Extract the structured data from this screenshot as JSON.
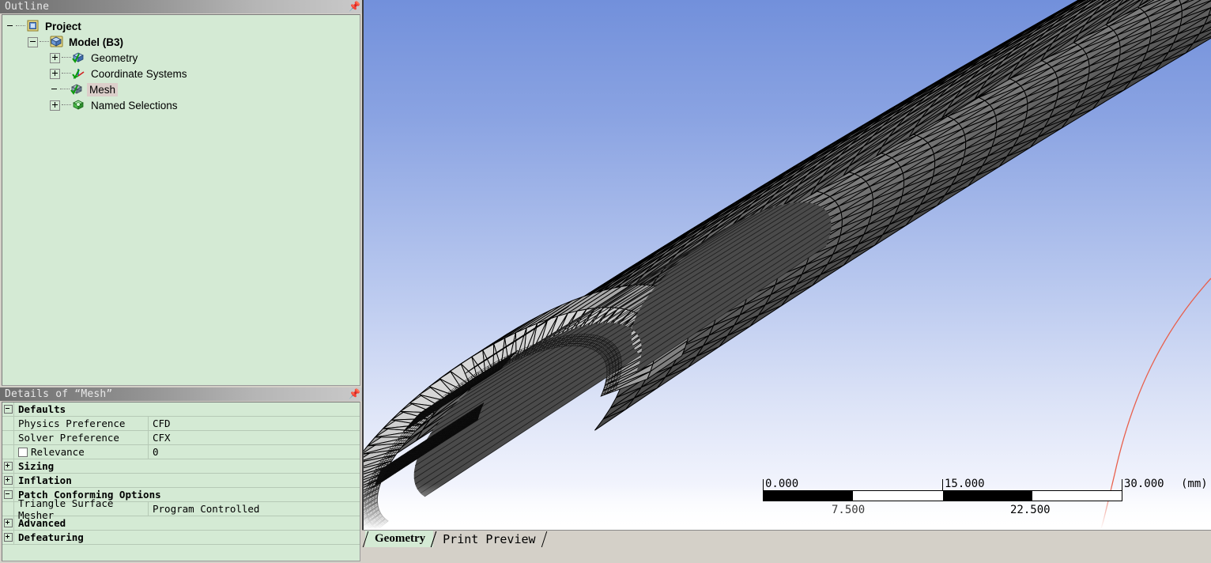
{
  "outline": {
    "title": "Outline",
    "pin_icon": "pin-icon",
    "tree": [
      {
        "label": "Project",
        "icon": "project-icon",
        "depth": 0,
        "expander": "none",
        "bold": true,
        "selected": false
      },
      {
        "label": "Model (B3)",
        "icon": "model-icon",
        "depth": 1,
        "expander": "minus",
        "bold": true,
        "selected": false
      },
      {
        "label": "Geometry",
        "icon": "geometry-icon",
        "depth": 2,
        "expander": "plus",
        "bold": false,
        "selected": false
      },
      {
        "label": "Coordinate Systems",
        "icon": "coordinate-systems-icon",
        "depth": 2,
        "expander": "plus",
        "bold": false,
        "selected": false
      },
      {
        "label": "Mesh",
        "icon": "mesh-icon",
        "depth": 2,
        "expander": "none",
        "bold": false,
        "selected": true
      },
      {
        "label": "Named Selections",
        "icon": "named-selections-icon",
        "depth": 2,
        "expander": "plus",
        "bold": false,
        "selected": false
      }
    ]
  },
  "details": {
    "title": "Details of “Mesh”",
    "pin_icon": "pin-icon",
    "rows": [
      {
        "kind": "header",
        "expander": "minus",
        "label": "Defaults"
      },
      {
        "kind": "property",
        "label": "Physics Preference",
        "value": "CFD"
      },
      {
        "kind": "property",
        "label": "Solver Preference",
        "value": "CFX"
      },
      {
        "kind": "property",
        "label": "Relevance",
        "value": "0",
        "checkbox": true
      },
      {
        "kind": "header",
        "expander": "plus",
        "label": "Sizing"
      },
      {
        "kind": "header",
        "expander": "plus",
        "label": "Inflation"
      },
      {
        "kind": "header",
        "expander": "minus",
        "label": "Patch Conforming Options"
      },
      {
        "kind": "property",
        "label": "Triangle Surface Mesher",
        "value": "Program Controlled"
      },
      {
        "kind": "header",
        "expander": "plus",
        "label": "Advanced"
      },
      {
        "kind": "header",
        "expander": "plus",
        "label": "Defeaturing"
      }
    ]
  },
  "viewport": {
    "scale_bar": {
      "ticks": [
        "0.000",
        "15.000",
        "30.000"
      ],
      "mid_label": "22.500",
      "low_mid_label": "7.500",
      "units": "(mm)"
    },
    "colors": {
      "background_top": "#7290db",
      "background_bottom": "#ffffff",
      "mesh_face_dark": "#6e6e6e",
      "mesh_face_light": "#c9c9c9",
      "mesh_edge": "#000000",
      "highlight_edge": "#e8604c"
    }
  },
  "tabs": [
    {
      "label": "Geometry",
      "active": true
    },
    {
      "label": "Print Preview",
      "active": false
    }
  ]
}
